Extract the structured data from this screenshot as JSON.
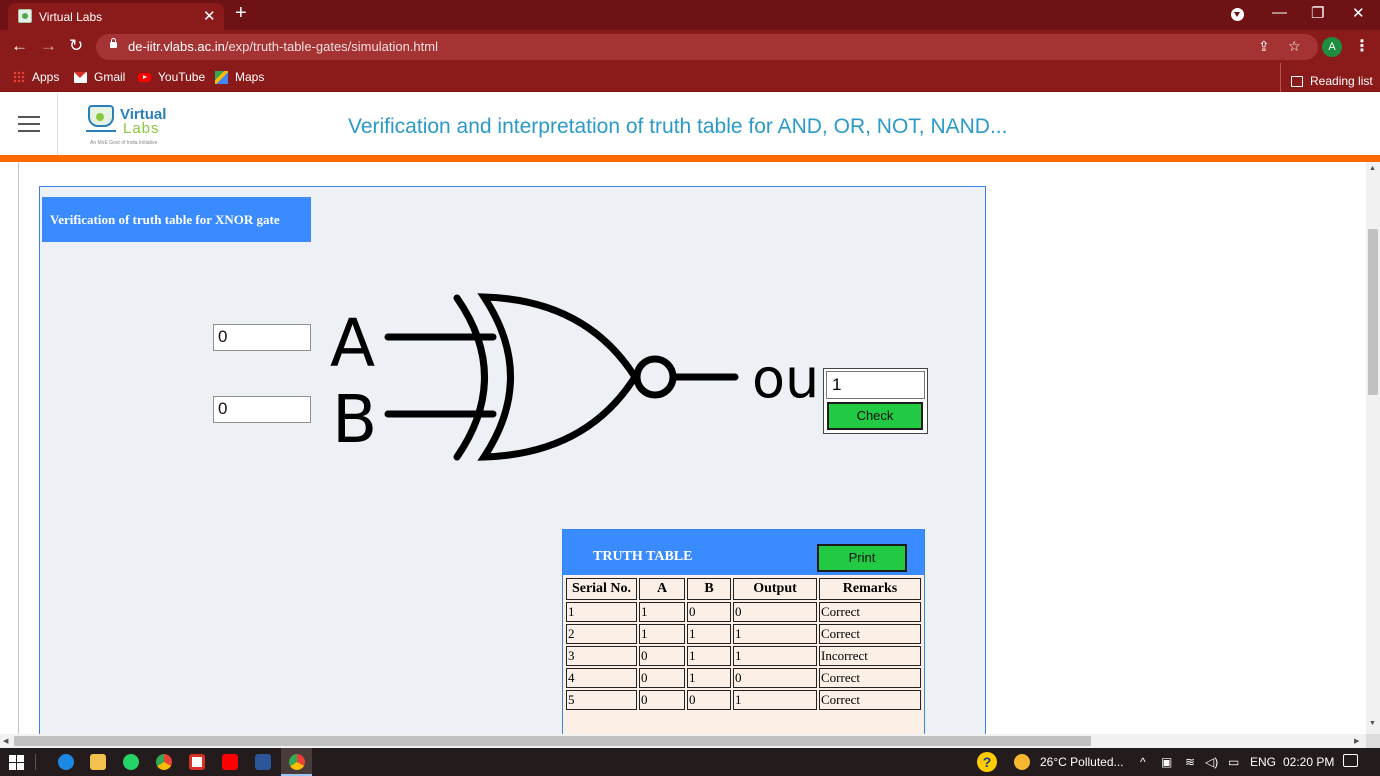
{
  "browser": {
    "tab_title": "Virtual Labs",
    "url_domain": "de-iitr.vlabs.ac.in",
    "url_path": "/exp/truth-table-gates/simulation.html",
    "profile_initial": "A",
    "bookmarks": [
      "Apps",
      "Gmail",
      "YouTube",
      "Maps"
    ],
    "reading_list": "Reading list"
  },
  "header": {
    "logo_primary": "Virtual",
    "logo_secondary": "Labs",
    "logo_tagline": "An MoE Govt of India Initiative",
    "page_title": "Verification and interpretation of truth table for AND, OR, NOT, NAND..."
  },
  "simulation": {
    "panel_title": "Verification of truth table for XNOR gate",
    "input_a": "0",
    "input_b": "0",
    "label_a": "A",
    "label_b": "B",
    "label_out": "out",
    "output_value": "1",
    "check_label": "Check"
  },
  "truth_table": {
    "title": "TRUTH TABLE",
    "print_label": "Print",
    "headers": [
      "Serial No.",
      "A",
      "B",
      "Output",
      "Remarks"
    ],
    "rows": [
      [
        "1",
        "1",
        "0",
        "0",
        "Correct"
      ],
      [
        "2",
        "1",
        "1",
        "1",
        "Correct"
      ],
      [
        "3",
        "0",
        "1",
        "1",
        "Incorrect"
      ],
      [
        "4",
        "0",
        "1",
        "0",
        "Correct"
      ],
      [
        "5",
        "0",
        "0",
        "1",
        "Correct"
      ]
    ]
  },
  "taskbar": {
    "weather": "26°C  Polluted...",
    "language": "ENG",
    "time": "02:20 PM"
  },
  "colors": {
    "browser_frame": "#8b1a1a",
    "accent_orange": "#ff6a00",
    "panel_blue": "#3a8bff",
    "button_green": "#22c943",
    "title_blue": "#2b9ac9"
  }
}
